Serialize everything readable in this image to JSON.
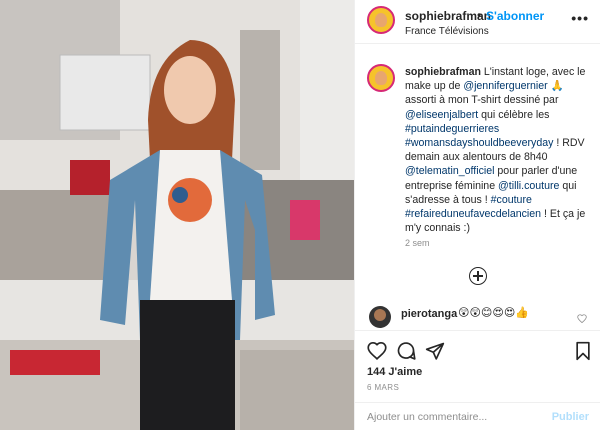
{
  "post": {
    "image_alt": "Photo of a woman in a denim shirt and illustrated T-shirt standing in a dressing room"
  },
  "header": {
    "username": "sophiebrafman",
    "separator": "•",
    "follow_label": "S'abonner",
    "location": "France Télévisions",
    "more_label": "•••"
  },
  "caption": {
    "username": "sophiebrafman",
    "parts": [
      {
        "type": "text",
        "value": " L'instant loge, avec le make up de "
      },
      {
        "type": "mention",
        "value": "@jenniferguernier"
      },
      {
        "type": "text",
        "value": " 🙏 assorti à mon T-shirt dessiné par "
      },
      {
        "type": "mention",
        "value": "@eliseenjalbert"
      },
      {
        "type": "text",
        "value": " qui célèbre les "
      },
      {
        "type": "mention",
        "value": "#putaindeguerrieres"
      },
      {
        "type": "text",
        "value": " "
      },
      {
        "type": "mention",
        "value": "#womansdayshouldbeeveryday"
      },
      {
        "type": "text",
        "value": " ! RDV demain aux alentours de 8h40 "
      },
      {
        "type": "mention",
        "value": "@telematin_officiel"
      },
      {
        "type": "text",
        "value": " pour parler d'une entreprise féminine "
      },
      {
        "type": "mention",
        "value": "@tilli.couture"
      },
      {
        "type": "text",
        "value": " qui s'adresse à tous ! "
      },
      {
        "type": "mention",
        "value": "#couture"
      },
      {
        "type": "text",
        "value": " "
      },
      {
        "type": "mention",
        "value": "#refaireduneufavecdelancien"
      },
      {
        "type": "text",
        "value": " ! Et ça je m'y connais :)"
      }
    ],
    "time": "2 sem"
  },
  "comment": {
    "username": "pierotanga",
    "text": "😲😲😊😍😍👍"
  },
  "actions": {
    "icons": [
      "heart-icon",
      "comment-icon",
      "share-icon",
      "bookmark-icon"
    ],
    "likes": "144 J'aime",
    "date": "6 MARS"
  },
  "add_comment": {
    "placeholder": "Ajouter un commentaire...",
    "publish_label": "Publier"
  }
}
